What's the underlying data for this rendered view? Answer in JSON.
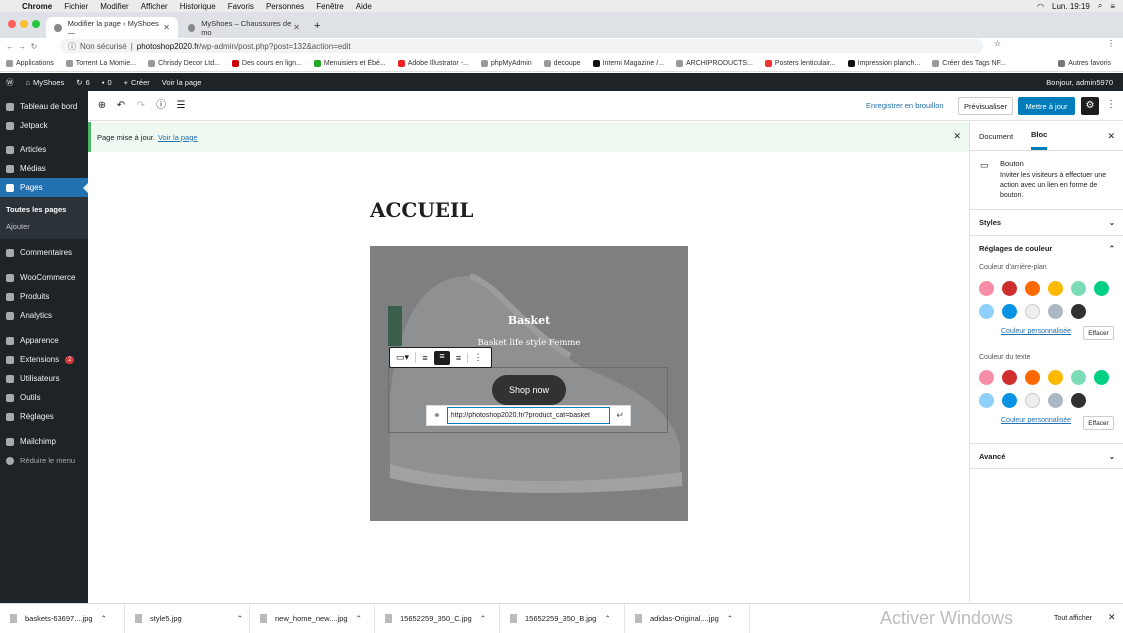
{
  "mac_menu": {
    "app": "Chrome",
    "items": [
      "Fichier",
      "Modifier",
      "Afficher",
      "Historique",
      "Favoris",
      "Personnes",
      "Fenêtre",
      "Aide"
    ],
    "clock": "Lun. 19:19"
  },
  "tabs": [
    {
      "label": "Modifier la page ‹ MyShoes —"
    },
    {
      "label": "MyShoes – Chaussures de mo"
    }
  ],
  "address": {
    "security": "Non sécurisé",
    "host": "photoshop2020.fr",
    "path": "/wp-admin/post.php?post=132&action=edit"
  },
  "bookmarks": [
    "Applications",
    "Torrent La Momie...",
    "Chrisdy Decor Ltd...",
    "Des cours en lign...",
    "Menuisiers et Ébé...",
    "Adobe Illustrator -...",
    "phpMyAdmin",
    "decoupe",
    "Interni Magazine /...",
    "ARCHIPRODUCTS...",
    "Posters lenticulair...",
    "Impression planch...",
    "Créer des Tags NF...",
    "Autres favoris"
  ],
  "wpbar": {
    "site": "MyShoes",
    "updates": "6",
    "comments": "0",
    "new": "Créer",
    "view": "Voir la page",
    "greeting": "Bonjour, admin5970"
  },
  "sidebar": {
    "items": [
      {
        "label": "Tableau de bord"
      },
      {
        "label": "Jetpack"
      },
      {
        "label": "Articles"
      },
      {
        "label": "Médias"
      },
      {
        "label": "Pages"
      },
      {
        "label": "Commentaires"
      },
      {
        "label": "WooCommerce"
      },
      {
        "label": "Produits"
      },
      {
        "label": "Analytics"
      },
      {
        "label": "Apparence"
      },
      {
        "label": "Extensions",
        "badge": "2"
      },
      {
        "label": "Utilisateurs"
      },
      {
        "label": "Outils"
      },
      {
        "label": "Réglages"
      },
      {
        "label": "Mailchimp"
      },
      {
        "label": "Réduire le menu"
      }
    ],
    "sub": [
      "Toutes les pages",
      "Ajouter"
    ]
  },
  "editor": {
    "save_draft": "Enregistrer en brouillon",
    "preview": "Prévisualiser",
    "update": "Mettre à jour"
  },
  "notice": {
    "text": "Page mise à jour.",
    "link": "Voir la page"
  },
  "content": {
    "title": "ACCUEIL",
    "cover_title": "Basket",
    "cover_sub": "Basket life style Femme",
    "button": "Shop now",
    "url_value": "http://photoshop2020.fr/?product_cat=basket"
  },
  "panel": {
    "tab_document": "Document",
    "tab_block": "Bloc",
    "block_name": "Bouton",
    "block_desc": "Inviter les visiteurs à effectuer une action avec un lien en forme de bouton.",
    "styles": "Styles",
    "color_settings": "Réglages de couleur",
    "bg_color": "Couleur d’arrière-plan",
    "text_color": "Couleur du texte",
    "custom": "Couleur personnalisée",
    "clear": "Effacer",
    "advanced": "Avancé"
  },
  "colors": [
    "#f78da7",
    "#cf2e2e",
    "#ff6900",
    "#fcb900",
    "#7bdcb5",
    "#00d084",
    "#8ed1fc",
    "#0693e3",
    "#eeeeee",
    "#abb8c3",
    "#313131"
  ],
  "downloads": [
    "baskets-63697....jpg",
    "style5.jpg",
    "new_home_new....jpg",
    "15652259_350_C.jpg",
    "15652259_350_B.jpg",
    "adidas-Original....jpg"
  ],
  "download_all": "Tout afficher",
  "watermark": "Activer Windows"
}
